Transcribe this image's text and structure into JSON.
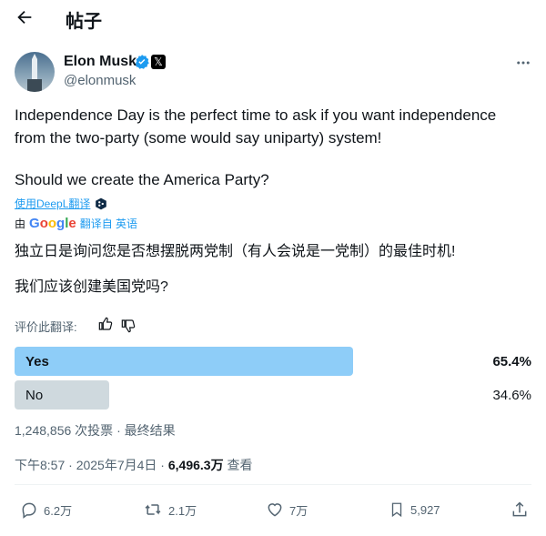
{
  "header": {
    "title": "帖子"
  },
  "author": {
    "name": "Elon Musk",
    "handle": "@elonmusk",
    "x_badge": "𝕏",
    "colors": {
      "verified": "#1d9bf0",
      "badge_bg": "#000000"
    }
  },
  "post": {
    "line1": "Independence Day is the perfect time to ask if you want independence",
    "line2": "from the two-party (some would say uniparty) system!",
    "line3": "Should we create the America Party?"
  },
  "translation": {
    "deepl_link": "使用DeepL翻译",
    "by_prefix": "由",
    "google": [
      "G",
      "o",
      "o",
      "g",
      "l",
      "e"
    ],
    "google_colors": [
      "#4285F4",
      "#EA4335",
      "#FBBC05",
      "#4285F4",
      "#34A853",
      "#EA4335"
    ],
    "from_lang": "翻译自 英语",
    "line1": "独立日是询问您是否想摆脱两党制（有人会说是一党制）的最佳时机!",
    "line2": "我们应该创建美国党吗?",
    "rate_label": "评价此翻译:"
  },
  "poll": {
    "options": [
      {
        "label": "Yes",
        "percent": "65.4%",
        "fraction": 0.654,
        "winner": true
      },
      {
        "label": "No",
        "percent": "34.6%",
        "fraction": 0.346,
        "winner": false
      }
    ],
    "votes": "1,248,856 次投票",
    "status": "· 最终结果",
    "colors": {
      "winner": "#8ecdf8",
      "other": "#cfd9de"
    }
  },
  "meta": {
    "time": "下午8:57",
    "date": "· 2025年7月4日 ·",
    "views": "6,496.3万",
    "views_label": "查看"
  },
  "actions": {
    "replies": "6.2万",
    "reposts": "2.1万",
    "likes": "7万",
    "bookmarks": "5,927"
  }
}
